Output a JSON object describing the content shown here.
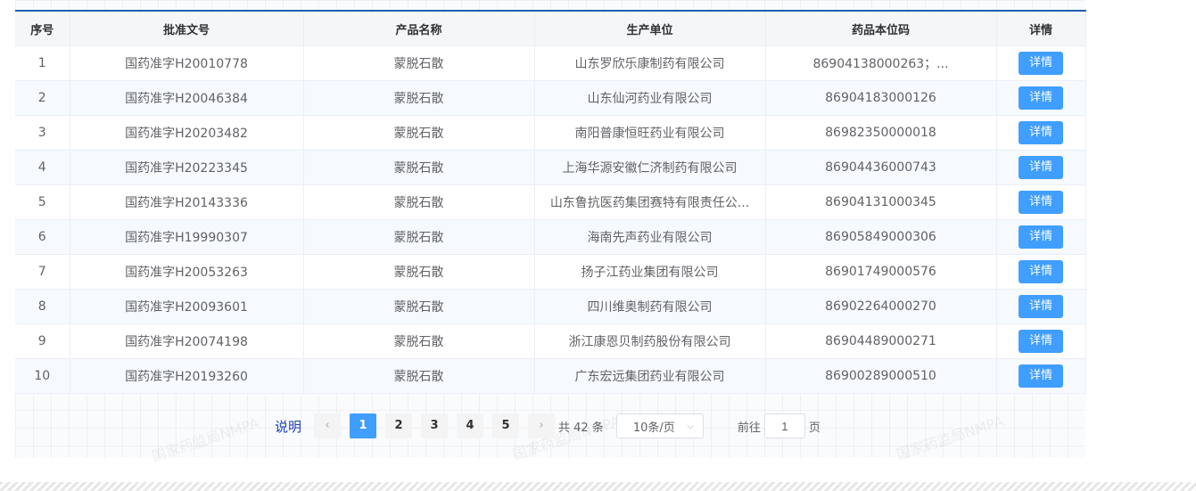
{
  "table": {
    "headers": [
      "序号",
      "批准文号",
      "产品名称",
      "生产单位",
      "药品本位码",
      "详情"
    ],
    "rows": [
      {
        "index": "1",
        "approval": "国药准字H20010778",
        "product": "蒙脱石散",
        "maker": "山东罗欣乐康制药有限公司",
        "code": "86904138000263；...",
        "action": "详情"
      },
      {
        "index": "2",
        "approval": "国药准字H20046384",
        "product": "蒙脱石散",
        "maker": "山东仙河药业有限公司",
        "code": "86904183000126",
        "action": "详情"
      },
      {
        "index": "3",
        "approval": "国药准字H20203482",
        "product": "蒙脱石散",
        "maker": "南阳普康恒旺药业有限公司",
        "code": "86982350000018",
        "action": "详情"
      },
      {
        "index": "4",
        "approval": "国药准字H20223345",
        "product": "蒙脱石散",
        "maker": "上海华源安徽仁济制药有限公司",
        "code": "86904436000743",
        "action": "详情"
      },
      {
        "index": "5",
        "approval": "国药准字H20143336",
        "product": "蒙脱石散",
        "maker": "山东鲁抗医药集团赛特有限责任公...",
        "code": "86904131000345",
        "action": "详情"
      },
      {
        "index": "6",
        "approval": "国药准字H19990307",
        "product": "蒙脱石散",
        "maker": "海南先声药业有限公司",
        "code": "86905849000306",
        "action": "详情"
      },
      {
        "index": "7",
        "approval": "国药准字H20053263",
        "product": "蒙脱石散",
        "maker": "扬子江药业集团有限公司",
        "code": "86901749000576",
        "action": "详情"
      },
      {
        "index": "8",
        "approval": "国药准字H20093601",
        "product": "蒙脱石散",
        "maker": "四川维奥制药有限公司",
        "code": "86902264000270",
        "action": "详情"
      },
      {
        "index": "9",
        "approval": "国药准字H20074198",
        "product": "蒙脱石散",
        "maker": "浙江康恩贝制药股份有限公司",
        "code": "86904489000271",
        "action": "详情"
      },
      {
        "index": "10",
        "approval": "国药准字H20193260",
        "product": "蒙脱石散",
        "maker": "广东宏远集团药业有限公司",
        "code": "86900289000510",
        "action": "详情"
      }
    ]
  },
  "pagination": {
    "help_label": "说明",
    "prev_icon": "chevron-left-icon",
    "next_icon": "chevron-right-icon",
    "pages": [
      "1",
      "2",
      "3",
      "4",
      "5"
    ],
    "current_page": "1",
    "total_label": "共 42 条",
    "page_size": "10条/页",
    "goto_label": "前往",
    "goto_value": "1",
    "page_unit": "页"
  },
  "watermark": "国家药监局NMPA",
  "colors": {
    "accent": "#409eff",
    "header_rule": "#1d5fb4",
    "help_link": "#1a3fb8"
  }
}
